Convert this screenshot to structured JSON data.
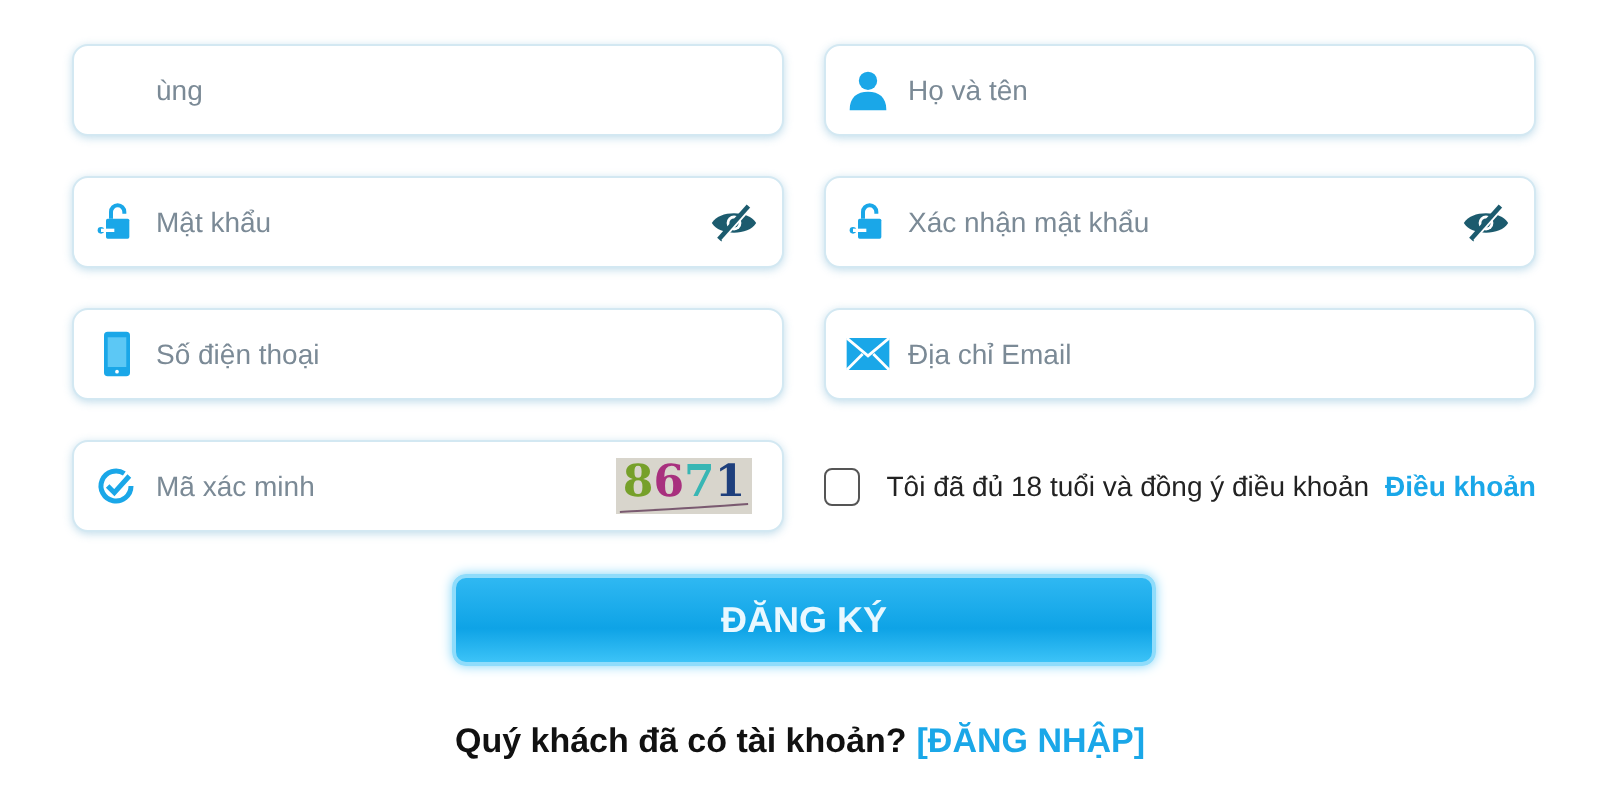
{
  "fields": [
    {
      "kind": "text",
      "placeholder": "ùng"
    },
    {
      "kind": "text",
      "placeholder": "Họ và tên"
    },
    {
      "kind": "password",
      "placeholder": "Mật khẩu"
    },
    {
      "kind": "password",
      "placeholder": "Xác nhận mật khẩu"
    },
    {
      "kind": "text",
      "placeholder": "Số điện thoại"
    },
    {
      "kind": "text",
      "placeholder": "Địa chỉ Email"
    },
    {
      "kind": "captcha",
      "placeholder": "Mã xác minh",
      "code": "8671"
    },
    {
      "kind": "agree",
      "checked": false,
      "label": "Tôi đã đủ 18 tuổi và đồng ý điều khoản",
      "link": "Điều khoản"
    }
  ],
  "submit": "ĐĂNG KÝ",
  "footer": {
    "text": "Quý khách đã có tài khoản?",
    "link": "[ĐĂNG NHẬP]"
  }
}
